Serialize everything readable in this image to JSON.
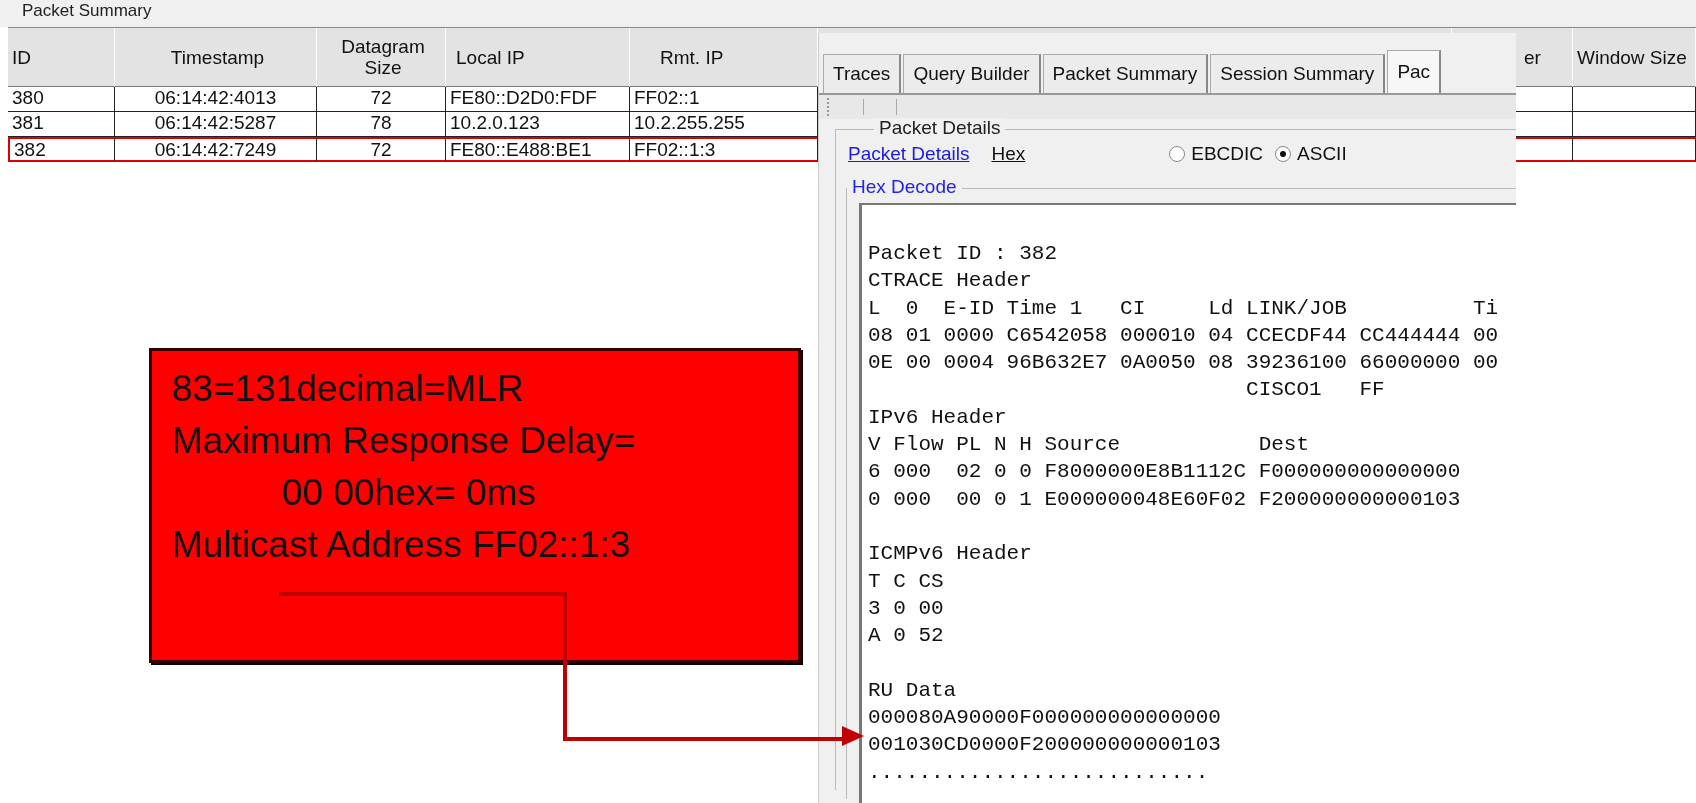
{
  "summary_group": {
    "title": "Packet Summary"
  },
  "table": {
    "columns": [
      "ID",
      "Timestamp",
      "Datagram Size",
      "Local IP",
      "Rmt. IP",
      "",
      "er",
      "Window Size"
    ],
    "rows": [
      {
        "cells": [
          "380",
          "06:14:42:4013",
          "72",
          "FE80::D2D0:FDF",
          "FF02::1",
          "",
          "",
          ""
        ],
        "selected": false
      },
      {
        "cells": [
          "381",
          "06:14:42:5287",
          "78",
          "10.2.0.123",
          "10.2.255.255",
          "",
          "",
          ""
        ],
        "selected": false
      },
      {
        "cells": [
          "382",
          "06:14:42:7249",
          "72",
          "FE80::E488:BE1",
          "FF02::1:3",
          "",
          "",
          ""
        ],
        "selected": true
      }
    ]
  },
  "panel": {
    "tabs": [
      {
        "label": "Traces",
        "selected": false
      },
      {
        "label": "Query Builder",
        "selected": false
      },
      {
        "label": "Packet Summary",
        "selected": false
      },
      {
        "label": "Session Summary",
        "selected": false
      },
      {
        "label": "Pac",
        "selected": true
      }
    ],
    "details_group": {
      "title": "Packet Details"
    },
    "links": [
      {
        "label": "Packet Details",
        "selected": false
      },
      {
        "label": "Hex",
        "selected": true
      }
    ],
    "radios": [
      {
        "label": "EBCDIC",
        "selected": false
      },
      {
        "label": "ASCII",
        "selected": true
      }
    ],
    "hex_group": {
      "title": "Hex Decode"
    },
    "hex_blocks": [
      [
        "Packet ID : 382",
        "CTRACE Header",
        "L  0  E-ID Time 1   CI     Ld LINK/JOB          Ti",
        "08 01 0000 C6542058 000010 04 CCECDF44 CC444444 00",
        "0E 00 0004 96B632E7 0A0050 08 39236100 66000000 00",
        "                              CISCO1   FF",
        "IPv6 Header",
        "V Flow PL N H Source           Dest",
        "6 000  02 0 0 F8000000E8B1112C F000000000000000",
        "0 000  00 0 1 E000000048E60F02 F200000000000103"
      ],
      [
        "ICMPv6 Header",
        "T C CS",
        "3 0 00",
        "A 0 52"
      ],
      [
        "RU Data",
        "000080A90000F000000000000000",
        "001030CD0000F200000000000103",
        "..........................."
      ]
    ]
  },
  "callout": {
    "lines": [
      {
        "text": "83=131decimal=MLR",
        "indented": false
      },
      {
        "text": "Maximum Response Delay=",
        "indented": false
      },
      {
        "text": "00 00hex= 0ms",
        "indented": true
      },
      {
        "text": "Multicast Address FF02::1:3",
        "indented": false
      }
    ]
  }
}
